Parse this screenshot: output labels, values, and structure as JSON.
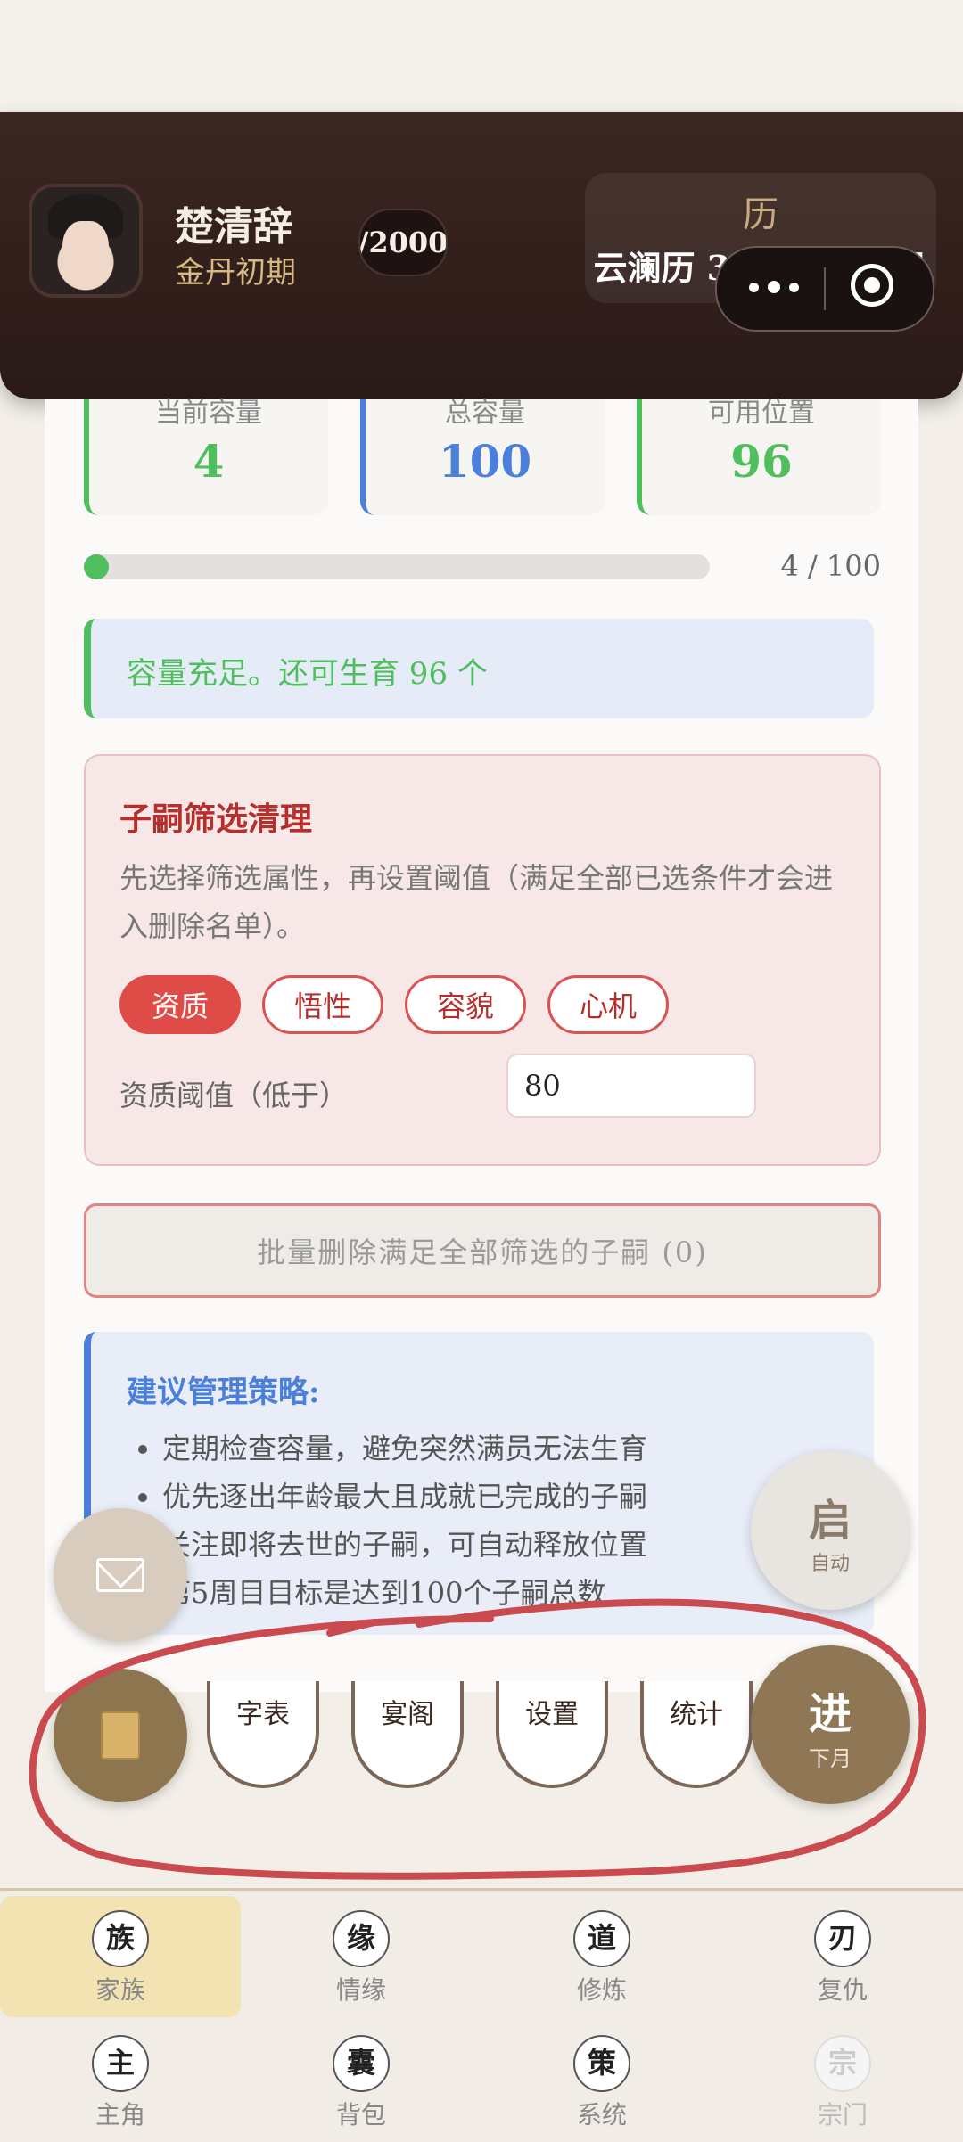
{
  "header": {
    "name": "楚清辞",
    "realm": "金丹初期",
    "exp": "/2000",
    "calendar_label": "历",
    "calendar_date": "云澜历 3576年 10月"
  },
  "stats": [
    {
      "label": "当前容量",
      "value": "4",
      "color": "#4fbe5c"
    },
    {
      "label": "总容量",
      "value": "100",
      "color": "#4a7fdb"
    },
    {
      "label": "可用位置",
      "value": "96",
      "color": "#4fbe5c"
    }
  ],
  "progress": {
    "current": 4,
    "total": 100,
    "text": "4 / 100"
  },
  "notice": "容量充足。还可生育 96 个",
  "filter": {
    "title": "子嗣筛选清理",
    "description": "先选择筛选属性，再设置阈值（满足全部已选条件才会进入删除名单）。",
    "chips": [
      "资质",
      "悟性",
      "容貌",
      "心机"
    ],
    "active_chip": "资质",
    "threshold_label": "资质阈值（低于）",
    "threshold_value": "80"
  },
  "batch_button": "批量删除满足全部筛选的子嗣 (0)",
  "advice": {
    "title": "建议管理策略:",
    "items": [
      "定期检查容量，避免突然满员无法生育",
      "优先逐出年龄最大且成就已完成的子嗣",
      "关注即将去世的子嗣，可自动释放位置",
      "第5周目目标是达到100个子嗣总数"
    ]
  },
  "fabs": {
    "auto_big": "启",
    "auto_small": "自动",
    "next_big": "进",
    "next_small": "下月"
  },
  "tabs": [
    "字表",
    "宴阁",
    "设置",
    "统计"
  ],
  "nav": [
    {
      "badge": "族",
      "label": "家族"
    },
    {
      "badge": "缘",
      "label": "情缘"
    },
    {
      "badge": "道",
      "label": "修炼"
    },
    {
      "badge": "刃",
      "label": "复仇"
    },
    {
      "badge": "主",
      "label": "主角"
    },
    {
      "badge": "囊",
      "label": "背包"
    },
    {
      "badge": "策",
      "label": "系统"
    },
    {
      "badge": "宗",
      "label": "宗门"
    }
  ],
  "colors": {
    "accent_red": "#df4b47",
    "green": "#4fbe5c",
    "blue": "#4a7fdb",
    "annotation": "#c94a4f"
  }
}
